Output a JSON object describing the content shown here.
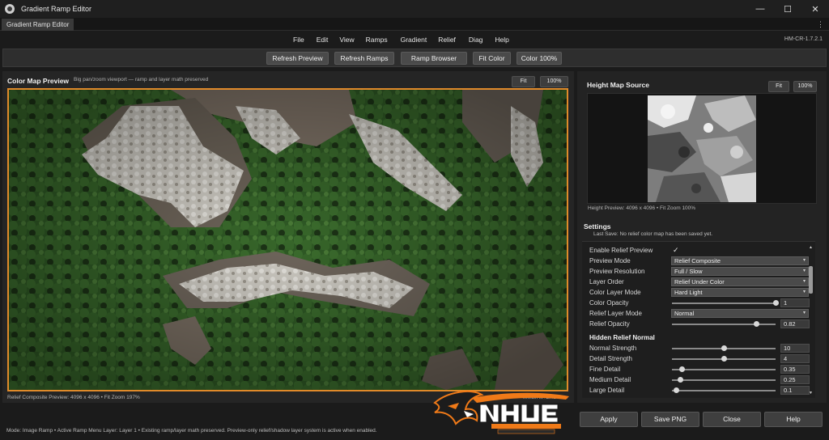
{
  "window": {
    "title": "Gradient Ramp Editor",
    "minimize": "—",
    "maximize": "☐",
    "close": "✕"
  },
  "tab": {
    "label": "Gradient Ramp Editor",
    "menu_glyph": "⋮"
  },
  "menu": {
    "items": [
      "File",
      "Edit",
      "View",
      "Ramps",
      "Gradient",
      "Relief",
      "Diag",
      "Help"
    ],
    "version": "HM-CR-1.7.2.1"
  },
  "toolbar": {
    "buttons": [
      "Refresh Preview",
      "Refresh Ramps",
      "Ramp Browser",
      "Fit Color",
      "Color 100%"
    ]
  },
  "color_map": {
    "title": "Color Map Preview",
    "subtitle": "Big pan/zoom viewport — ramp and layer math preserved",
    "fit": "Fit",
    "zoom100": "100%",
    "status_left": "Relief Composite Preview: 4096 x 4096  •  Fit Zoom 197%",
    "status_right": "MMB/Alt+LMB Pan"
  },
  "height_map": {
    "title": "Height Map Source",
    "fit": "Fit",
    "zoom100": "100%",
    "caption": "Height Preview: 4096 x 4096  •  Fit Zoom 100%"
  },
  "settings": {
    "title": "Settings",
    "last_save": "Last Save: No relief color map has been saved yet.",
    "enable_relief_label": "Enable Relief Preview",
    "enable_relief_checked": true,
    "check_glyph": "✓",
    "combos": [
      {
        "label": "Preview Mode",
        "value": "Relief Composite"
      },
      {
        "label": "Preview Resolution",
        "value": "Full / Slow"
      },
      {
        "label": "Layer Order",
        "value": "Relief Under Color"
      },
      {
        "label": "Color Layer Mode",
        "value": "Hard Light"
      }
    ],
    "color_opacity": {
      "label": "Color Opacity",
      "value": "1",
      "level": 1.0
    },
    "relief_layer_mode": {
      "label": "Relief Layer Mode",
      "value": "Normal"
    },
    "relief_opacity": {
      "label": "Relief Opacity",
      "value": "0.82",
      "level": 0.82
    },
    "group_title": "Hidden Relief Normal",
    "sliders": [
      {
        "label": "Normal Strength",
        "value": "10",
        "level": 0.5
      },
      {
        "label": "Detail Strength",
        "value": "4",
        "level": 0.5
      },
      {
        "label": "Fine Detail",
        "value": "0.35",
        "level": 0.1
      },
      {
        "label": "Medium Detail",
        "value": "0.25",
        "level": 0.08
      },
      {
        "label": "Large Detail",
        "value": "0.1",
        "level": 0.04
      }
    ],
    "dropdown_glyph": "▾",
    "scroll_up": "▲",
    "scroll_down": "▼"
  },
  "status": {
    "text": "Mode: Image Ramp  •  Active Ramp Menu Layer: Layer 1  •  Existing ramp/layer math preserved. Preview-only relief/shadow layer system is active when enabled."
  },
  "logo": {
    "main": "NHUE",
    "tagline": "NIGHT HAWK'S",
    "sub": "ULTIMATE EDITOR"
  },
  "actions": {
    "buttons": [
      "Apply",
      "Save PNG",
      "Close",
      "Help"
    ]
  },
  "colors": {
    "accent_border": "#e08a2a",
    "forest": "#2f5a25",
    "rock": "#d8d6d0",
    "logo_orange": "#f07a18"
  }
}
